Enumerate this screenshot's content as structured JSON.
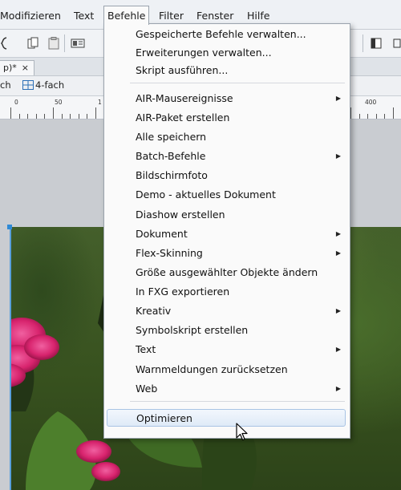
{
  "menubar": {
    "items": [
      "Modifizieren",
      "Text",
      "Befehle",
      "Filter",
      "Fenster",
      "Hilfe"
    ],
    "active": "Befehle"
  },
  "toolbar": {
    "icons": [
      "brace-icon",
      "copy-icon",
      "paste-icon",
      "layout-icon",
      "panel-icon",
      "view-icon"
    ]
  },
  "tabs": {
    "document_tab": "p)*",
    "close_glyph": "×"
  },
  "view": {
    "left_text": "ch",
    "four_up": "4-fach"
  },
  "ruler": {
    "labels": [
      "0",
      "50",
      "1",
      "400"
    ]
  },
  "dropdown": {
    "items": [
      {
        "label": "Gespeicherte Befehle verwalten...",
        "submenu": false
      },
      {
        "label": "Erweiterungen verwalten...",
        "submenu": false
      },
      {
        "label": "Skript ausführen...",
        "submenu": false
      },
      {
        "label": "AIR-Mausereignisse",
        "submenu": true
      },
      {
        "label": "AIR-Paket erstellen",
        "submenu": false
      },
      {
        "label": "Alle speichern",
        "submenu": false
      },
      {
        "label": "Batch-Befehle",
        "submenu": true
      },
      {
        "label": "Bildschirmfoto",
        "submenu": false
      },
      {
        "label": "Demo - aktuelles Dokument",
        "submenu": false
      },
      {
        "label": "Diashow erstellen",
        "submenu": false
      },
      {
        "label": "Dokument",
        "submenu": true
      },
      {
        "label": "Flex-Skinning",
        "submenu": true
      },
      {
        "label": "Größe ausgewählter Objekte ändern",
        "submenu": false
      },
      {
        "label": "In FXG exportieren",
        "submenu": false
      },
      {
        "label": "Kreativ",
        "submenu": true
      },
      {
        "label": "Symbolskript erstellen",
        "submenu": false
      },
      {
        "label": "Text",
        "submenu": true
      },
      {
        "label": "Warnmeldungen zurücksetzen",
        "submenu": false
      },
      {
        "label": "Web",
        "submenu": true
      },
      {
        "label": "Optimieren",
        "submenu": false,
        "highlighted": true
      }
    ],
    "submenu_arrow": "▶"
  },
  "colors": {
    "highlight_border": "#a9c4e4",
    "selection_blue": "#2f8ad6",
    "flower_pink": "#d8246e"
  }
}
